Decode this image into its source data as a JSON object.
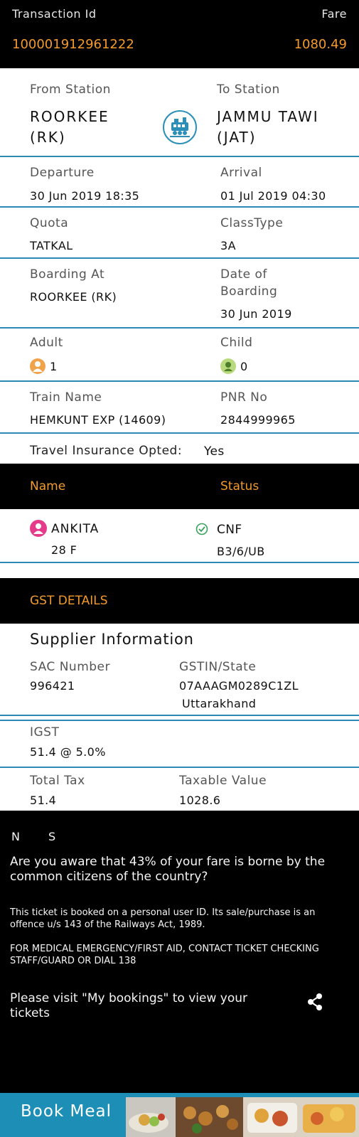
{
  "header": {
    "transaction_label": "Transaction Id",
    "fare_label": "Fare",
    "transaction_id": "100001912961222",
    "fare": "1080.49"
  },
  "journey": {
    "from_label": "From Station",
    "to_label": "To Station",
    "from_name": "ROORKEE",
    "from_code": "(RK)",
    "to_name": "JAMMU TAWI",
    "to_code": "(JAT)",
    "departure_label": "Departure",
    "arrival_label": "Arrival",
    "departure": "30 Jun 2019  18:35",
    "arrival": "01 Jul 2019  04:30",
    "quota_label": "Quota",
    "class_label": "ClassType",
    "quota": "TATKAL",
    "class": "3A",
    "boarding_label": "Boarding At",
    "boarding": "ROORKEE (RK)",
    "date_boarding_label_1": "Date of",
    "date_boarding_label_2": "Boarding",
    "date_boarding": "30 Jun 2019",
    "adult_label": "Adult",
    "child_label": "Child",
    "adult_count": "1",
    "child_count": "0",
    "train_label": "Train Name",
    "pnr_label": "PNR No",
    "train": "HEMKUNT EXP (14609)",
    "pnr": "2844999965",
    "insurance_label": "Travel Insurance Opted:",
    "insurance": "Yes"
  },
  "passengers": {
    "name_header": "Name",
    "status_header": "Status",
    "list": [
      {
        "name": "ANKITA",
        "age_gender": "28 F",
        "status": "CNF",
        "berth": "B3/6/UB"
      }
    ]
  },
  "gst": {
    "title": "GST DETAILS",
    "supplier_title": "Supplier Information",
    "sac_label": "SAC Number",
    "sac": "996421",
    "gstin_label": "GSTIN/State",
    "gstin": "07AAAGM0289C1ZL",
    "state": "Uttarakhand",
    "igst_label": "IGST",
    "igst": "51.4 @ 5.0%",
    "total_tax_label": "Total Tax",
    "total_tax": "51.4",
    "taxable_label": "Taxable Value",
    "taxable": "1028.6"
  },
  "footer": {
    "ns_n": "N",
    "ns_s": "S",
    "awareness": "Are you aware that 43% of your fare is borne by the common citizens of the country?",
    "personal_id": "This ticket is booked on a personal user ID. Its sale/purchase is an offence u/s 143 of the Railways Act, 1989.",
    "emergency": "FOR MEDICAL EMERGENCY/FIRST AID, CONTACT TICKET CHECKING STAFF/GUARD OR DIAL 138",
    "visit": "Please visit \"My bookings\" to view your tickets",
    "book_meal": "Book Meal"
  },
  "icons": {
    "train": "train-icon",
    "adult": "adult-icon",
    "child": "child-icon",
    "female": "female-passenger-icon",
    "check": "check-circle-icon",
    "share": "share-icon"
  },
  "colors": {
    "accent": "#f39a2c",
    "divider": "#2c89b5",
    "meal_bar": "#1d8fb6"
  }
}
